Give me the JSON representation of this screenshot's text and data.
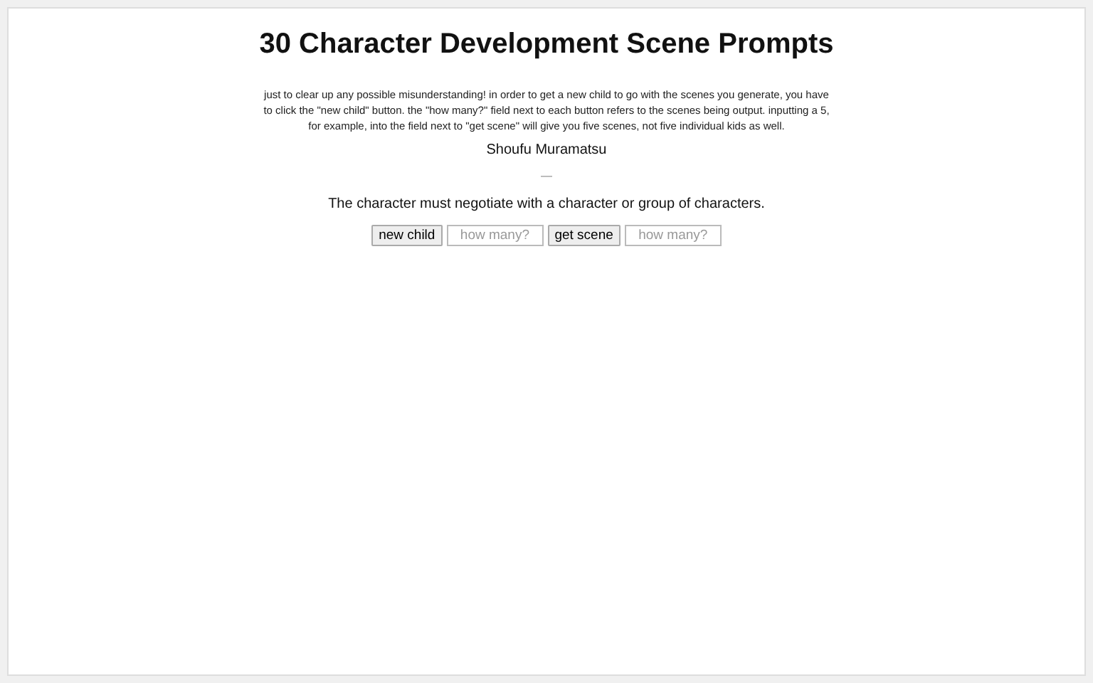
{
  "title": "30 Character Development Scene Prompts",
  "note": "just to clear up any possible misunderstanding! in order to get a new child to go with the scenes you generate, you have to click the \"new child\" button. the \"how many?\" field next to each button refers to the scenes being output. inputting a 5, for example, into the field next to \"get scene\" will give you five scenes, not five individual kids as well.",
  "child": "Shoufu Muramatsu",
  "separator": "—",
  "scene": "The character must negotiate with a character or group of characters.",
  "controls": [
    {
      "button": "new child",
      "placeholder": "how many?"
    },
    {
      "button": "get scene",
      "placeholder": "how many?"
    }
  ]
}
